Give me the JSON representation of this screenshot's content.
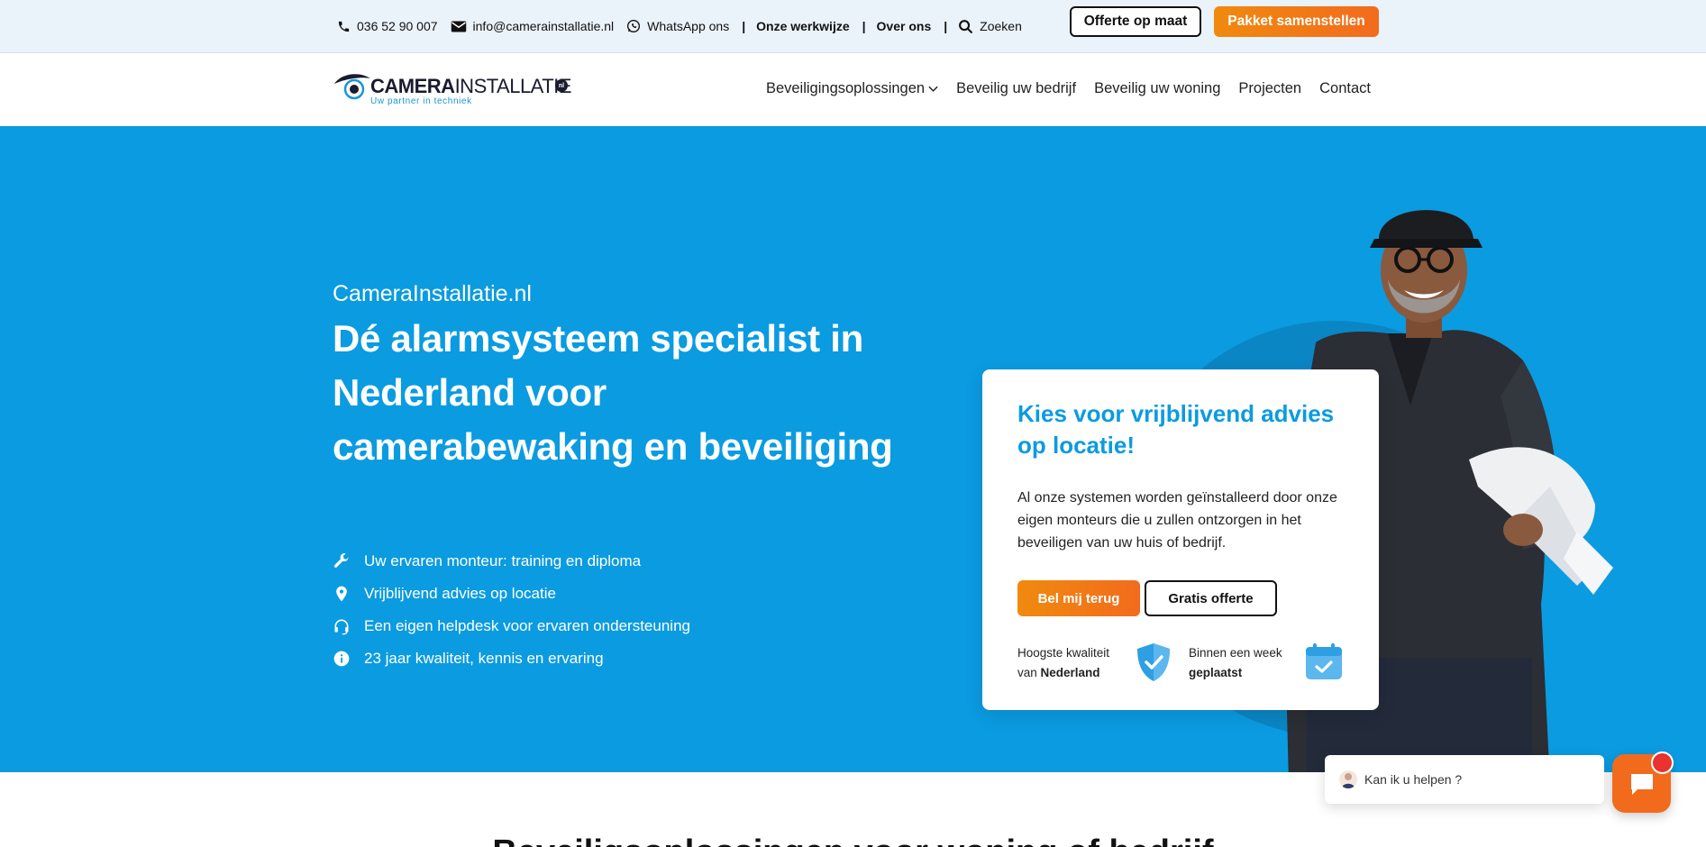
{
  "topbar": {
    "phone": "036 52 90 007",
    "email": "info@camerainstallatie.nl",
    "whatsapp": "WhatsApp ons",
    "werkwijze": "Onze werkwijze",
    "over_ons": "Over ons",
    "search": "Zoeken",
    "offerte_btn": "Offerte op maat",
    "pakket_btn": "Pakket samenstellen",
    "separator": "|"
  },
  "logo": {
    "brand_bold": "CAMERA",
    "brand_regular": "INSTALLATIE",
    "badge": "nl",
    "tagline": "Uw partner in techniek"
  },
  "nav": {
    "items": [
      "Beveiligingsoplossingen",
      "Beveilig uw bedrijf",
      "Beveilig uw woning",
      "Projecten",
      "Contact"
    ]
  },
  "hero": {
    "kicker": "CameraInstallatie.nl",
    "headline": "Dé alarmsysteem specialist in Nederland voor camerabewaking en beveiliging",
    "features": [
      "Uw ervaren monteur: training en diploma",
      "Vrijblijvend advies op locatie",
      "Een eigen helpdesk voor ervaren ondersteuning",
      "23 jaar kwaliteit, kennis en ervaring"
    ]
  },
  "card": {
    "title": "Kies voor vrijblijvend advies op locatie!",
    "body": "Al onze systemen worden geïnstalleerd door onze eigen monteurs die u zullen ontzorgen in het beveiligen van uw huis of bedrijf.",
    "call_btn": "Bel mij terug",
    "quote_btn": "Gratis offerte",
    "usp1_line1": "Hoogste kwaliteit",
    "usp1_prefix": "van ",
    "usp1_bold": "Nederland",
    "usp2_line1": "Binnen een week",
    "usp2_bold": "geplaatst"
  },
  "chat": {
    "prompt": "Kan ik u helpen ?"
  },
  "section": {
    "heading": "Beveiligsoplossingen voor woning of bedrijf"
  },
  "colors": {
    "hero_blue": "#0b9be0",
    "orange": "#f26b1d",
    "topbar_bg": "#eaf2fa"
  }
}
